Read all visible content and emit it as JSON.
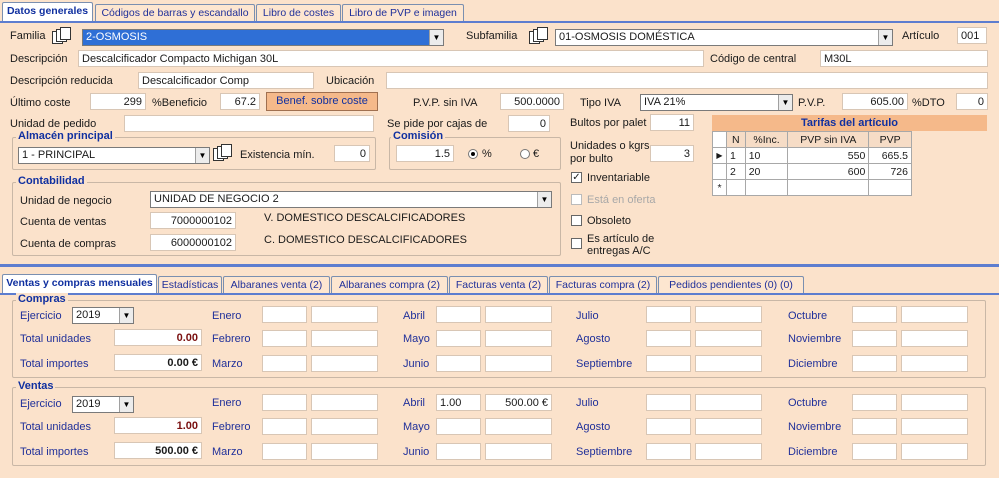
{
  "top_tabs": [
    "Datos generales",
    "Códigos de barras y escandallo",
    "Libro de costes",
    "Libro de PVP e imagen"
  ],
  "fields": {
    "familia_label": "Familia",
    "familia_value": "2-OSMOSIS",
    "subfamilia_label": "Subfamilia",
    "subfamilia_value": "01-OSMOSIS DOMÉSTICA",
    "articulo_label": "Artículo",
    "articulo_value": "001",
    "descripcion_label": "Descripción",
    "descripcion_value": "Descalcificador Compacto Michigan 30L",
    "codigo_central_label": "Código de central",
    "codigo_central_value": "M30L",
    "desc_reducida_label": "Descripción reducida",
    "desc_reducida_value": "Descalcificador Comp",
    "ubicacion_label": "Ubicación",
    "ubicacion_value": "",
    "ultimo_coste_label": "Último coste",
    "ultimo_coste_value": "299",
    "beneficio_label": "%Beneficio",
    "beneficio_value": "67.2",
    "benef_button": "Benef. sobre coste",
    "pvp_sin_iva_label": "P.V.P. sin IVA",
    "pvp_sin_iva_value": "500.0000",
    "tipo_iva_label": "Tipo IVA",
    "tipo_iva_value": "IVA 21%",
    "pvp_label": "P.V.P.",
    "pvp_value": "605.00",
    "dto_label": "%DTO",
    "dto_value": "0",
    "unidad_pedido_label": "Unidad de pedido",
    "unidad_pedido_value": "",
    "cajas_label": "Se pide por cajas de",
    "cajas_value": "0",
    "bultos_label": "Bultos por palet",
    "bultos_value": "11",
    "unidades_kgrs_label": "Unidades o kgrs. por bulto",
    "unidades_kgrs_value": "3"
  },
  "almacen": {
    "title": "Almacén principal",
    "value": "1 - PRINCIPAL",
    "existencia_label": "Existencia mín.",
    "existencia_value": "0"
  },
  "comision": {
    "title": "Comisión",
    "value": "1.5",
    "pct": "%",
    "eur": "€"
  },
  "contabilidad": {
    "title": "Contabilidad",
    "unidad_negocio_label": "Unidad de negocio",
    "unidad_negocio_value": "UNIDAD DE NEGOCIO 2",
    "cuenta_ventas_label": "Cuenta de ventas",
    "cuenta_ventas_value": "7000000102",
    "cuenta_ventas_desc": "V. DOMESTICO DESCALCIFICADORES",
    "cuenta_compras_label": "Cuenta de compras",
    "cuenta_compras_value": "6000000102",
    "cuenta_compras_desc": "C. DOMESTICO DESCALCIFICADORES"
  },
  "checks": {
    "inventariable": "Inventariable",
    "oferta": "Está en oferta",
    "obsoleto": "Obsoleto",
    "entregas": "Es artículo de entregas A/C"
  },
  "tarifas": {
    "title": "Tarifas del artículo",
    "headers": [
      "N",
      "%Inc.",
      "PVP sin IVA",
      "PVP"
    ],
    "rows": [
      [
        "1",
        "10",
        "550",
        "665.5"
      ],
      [
        "2",
        "20",
        "600",
        "726"
      ]
    ]
  },
  "bottom_tabs": [
    "Ventas y compras mensuales",
    "Estadísticas",
    "Albaranes venta (2)",
    "Albaranes compra (2)",
    "Facturas venta (2)",
    "Facturas compra (2)",
    "Pedidos pendientes (0) (0)"
  ],
  "months": [
    "Enero",
    "Febrero",
    "Marzo",
    "Abril",
    "Mayo",
    "Junio",
    "Julio",
    "Agosto",
    "Septiembre",
    "Octubre",
    "Noviembre",
    "Diciembre"
  ],
  "compras": {
    "title": "Compras",
    "ejercicio_label": "Ejercicio",
    "ejercicio_value": "2019",
    "tu_label": "Total unidades",
    "tu_value": "0.00",
    "ti_label": "Total importes",
    "ti_value": "0.00 €"
  },
  "ventas": {
    "title": "Ventas",
    "ejercicio_label": "Ejercicio",
    "ejercicio_value": "2019",
    "tu_label": "Total unidades",
    "tu_value": "1.00",
    "ti_label": "Total importes",
    "ti_value": "500.00 €",
    "abril_units": "1.00",
    "abril_amount": "500.00 €"
  }
}
